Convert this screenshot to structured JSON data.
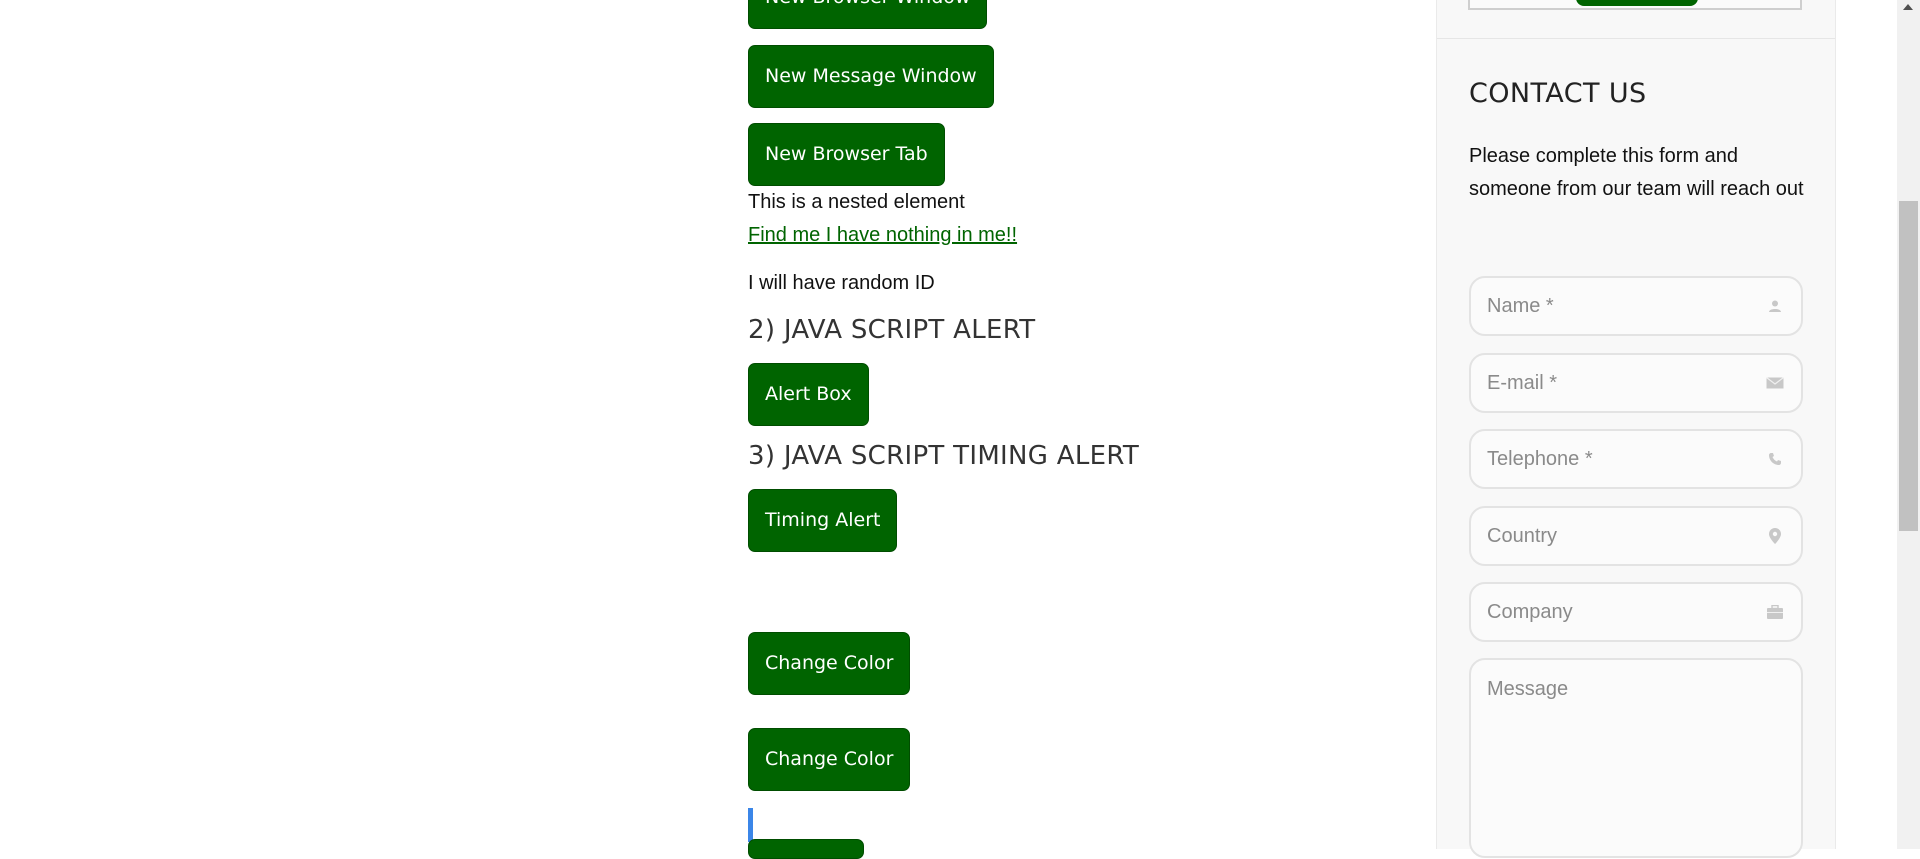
{
  "main": {
    "buttons": {
      "new_browser_window": "New Browser Window",
      "new_message_window": "New Message Window",
      "new_browser_tab": "New Browser Tab",
      "alert_box": "Alert Box",
      "timing_alert": "Timing Alert",
      "change_color_1": "Change Color",
      "change_color_2": "Change Color"
    },
    "nested_text": "This is a nested element",
    "find_me_link": "Find me I have nothing in me!!",
    "random_id_text": "I will have random ID",
    "heading_js_alert": "2) JAVA SCRIPT ALERT",
    "heading_js_timing_alert": "3) JAVA SCRIPT TIMING ALERT"
  },
  "sidebar": {
    "title": "CONTACT US",
    "description": "Please complete this form and someone from our team will reach out",
    "fields": {
      "name": "Name *",
      "email": "E-mail *",
      "telephone": "Telephone *",
      "country": "Country",
      "company": "Company",
      "message": "Message"
    },
    "icons": {
      "name": "user-icon",
      "email": "envelope-icon",
      "telephone": "phone-icon",
      "country": "map-pin-icon",
      "company": "briefcase-icon"
    }
  },
  "colors": {
    "accent": "#006400",
    "caret": "#3b86e8"
  }
}
